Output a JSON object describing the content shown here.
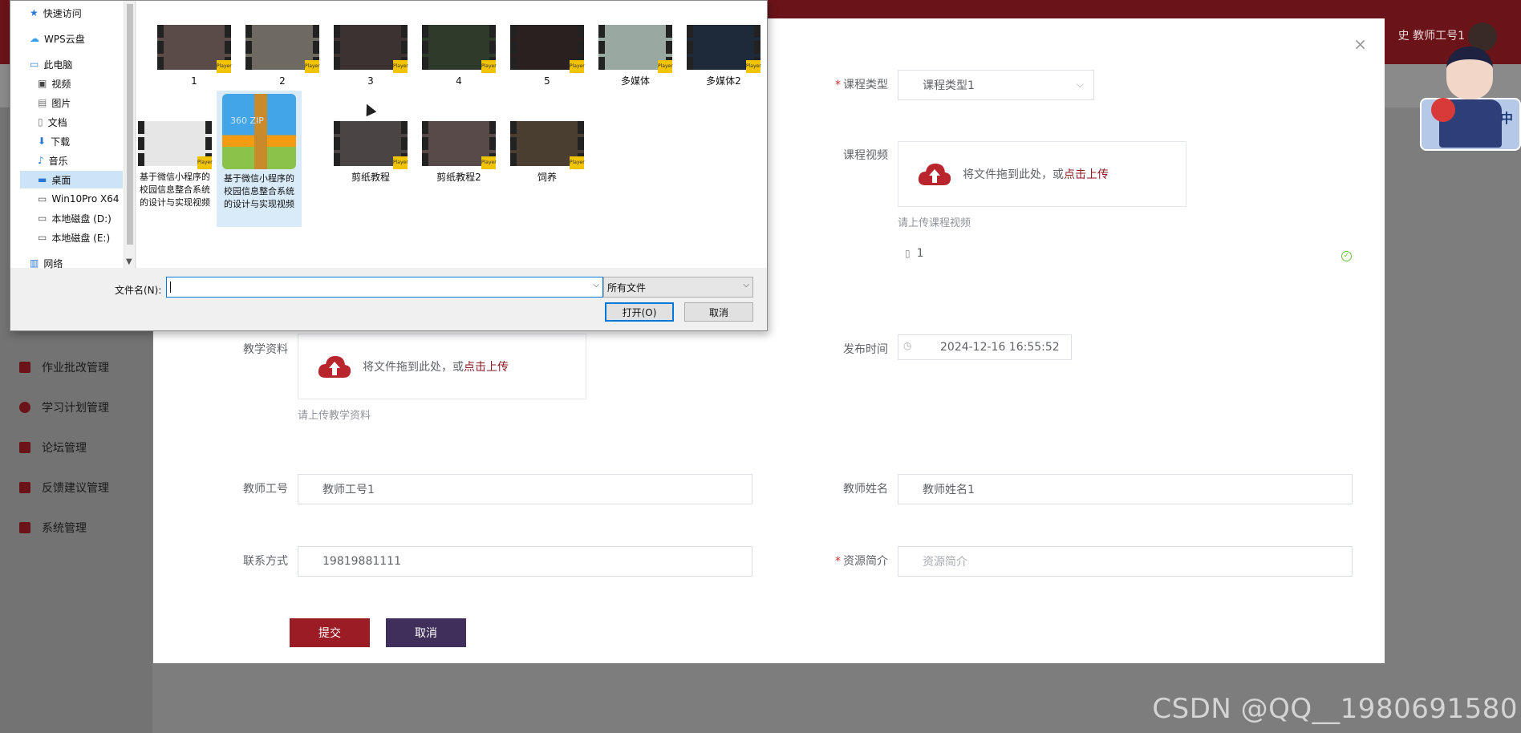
{
  "topbar": {
    "user_text": "史 教师工号1",
    "dropdown_glyph": "⌵"
  },
  "sidebar": {
    "items": [
      {
        "label": "作业批改管理",
        "icon": "grid-icon"
      },
      {
        "label": "学习计划管理",
        "icon": "circle-icon"
      },
      {
        "label": "论坛管理",
        "icon": "grid-icon"
      },
      {
        "label": "反馈建议管理",
        "icon": "grid-icon"
      },
      {
        "label": "系统管理",
        "icon": "grid-icon"
      }
    ]
  },
  "form": {
    "close_glyph": "×",
    "course_type": {
      "label": "课程类型",
      "value": "课程类型1"
    },
    "course_video": {
      "label": "课程视频",
      "upload_text": "将文件拖到此处，或",
      "upload_link": "点击上传",
      "hint": "请上传课程视频",
      "file_name": "1"
    },
    "teaching_material": {
      "label": "教学资料",
      "upload_text": "将文件拖到此处，或",
      "upload_link": "点击上传",
      "hint": "请上传教学资料"
    },
    "publish_time": {
      "label": "发布时间",
      "value": "2024-12-16 16:55:52"
    },
    "teacher_id": {
      "label": "教师工号",
      "value": "教师工号1"
    },
    "teacher_name": {
      "label": "教师姓名",
      "value": "教师姓名1"
    },
    "contact": {
      "label": "联系方式",
      "value": "19819881111"
    },
    "resource_intro": {
      "label": "资源简介",
      "placeholder": "资源简介"
    },
    "submit_label": "提交",
    "cancel_label": "取消",
    "required_mark": "*"
  },
  "dialog": {
    "nav": [
      {
        "label": "快速访问",
        "icon": "star-icon"
      },
      {
        "label": "WPS云盘",
        "icon": "cloud-icon"
      },
      {
        "label": "此电脑",
        "icon": "computer-icon"
      },
      {
        "label": "视频",
        "icon": "video-folder-icon"
      },
      {
        "label": "图片",
        "icon": "picture-folder-icon"
      },
      {
        "label": "文档",
        "icon": "document-folder-icon"
      },
      {
        "label": "下载",
        "icon": "download-icon"
      },
      {
        "label": "音乐",
        "icon": "music-icon"
      },
      {
        "label": "桌面",
        "icon": "desktop-icon"
      },
      {
        "label": "Win10Pro X64",
        "icon": "drive-icon"
      },
      {
        "label": "本地磁盘 (D:)",
        "icon": "drive-icon"
      },
      {
        "label": "本地磁盘 (E:)",
        "icon": "drive-icon"
      },
      {
        "label": "网络",
        "icon": "network-icon"
      }
    ],
    "files": [
      {
        "name": "1"
      },
      {
        "name": "2"
      },
      {
        "name": "3"
      },
      {
        "name": "4"
      },
      {
        "name": "5"
      },
      {
        "name": "多媒体"
      },
      {
        "name": "多媒体2"
      },
      {
        "name": "基于微信小程序的校园信息整合系统的设计与实现视频"
      },
      {
        "name": "基于微信小程序的校园信息整合系统的设计与实现视频"
      },
      {
        "name": "剪纸教程"
      },
      {
        "name": "剪纸教程2"
      },
      {
        "name": "饲养"
      }
    ],
    "player_badge": "Player",
    "zip_text": "360 ZIP",
    "filename_label": "文件名(N):",
    "filename_value": "",
    "filetype_value": "所有文件",
    "open_label": "打开(O)",
    "cancel_label": "取消"
  },
  "mascot": {
    "char": "中"
  },
  "watermark": "CSDN @QQ__1980691580",
  "colors": {
    "brand": "#6a1419",
    "submit": "#9b1c25",
    "cancel": "#3f2f5a",
    "link": "#8a1a22"
  }
}
